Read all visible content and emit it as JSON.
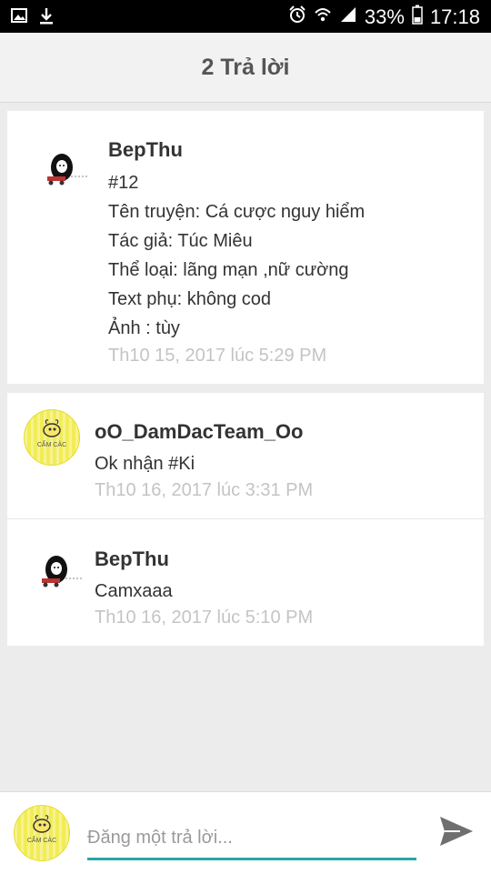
{
  "status_bar": {
    "battery": "33%",
    "time": "17:18"
  },
  "header": {
    "title": "2 Trả lời"
  },
  "original_post": {
    "author": "BepThu",
    "lines": [
      "#12",
      "Tên truyện: Cá cược nguy hiểm",
      "Tác giả: Túc Miêu",
      "Thể loại: lãng mạn ,nữ cường",
      "Text phụ: không cod",
      "Ảnh : tùy"
    ],
    "timestamp": "Th10 15, 2017 lúc 5:29 PM"
  },
  "replies": [
    {
      "author": "oO_DamDacTeam_Oo",
      "text": "Ok nhận #Ki",
      "timestamp": "Th10 16, 2017 lúc 3:31 PM",
      "avatar_label": "CẨM CẢC"
    },
    {
      "author": "BepThu",
      "text": "Camxaaa",
      "timestamp": "Th10 16, 2017 lúc 5:10 PM"
    }
  ],
  "composer": {
    "placeholder": "Đăng một trả lời...",
    "avatar_label": "CẨM CẢC"
  },
  "icons": {
    "status_left": [
      "image-icon",
      "download-icon"
    ],
    "status_right": [
      "alarm-icon",
      "wifi-icon",
      "signal-icon",
      "battery-icon"
    ],
    "send": "send-icon"
  },
  "colors": {
    "accent": "#26a7a7",
    "timestamp": "#c4c4c4",
    "avatar_yellow": "#f2ec57"
  }
}
